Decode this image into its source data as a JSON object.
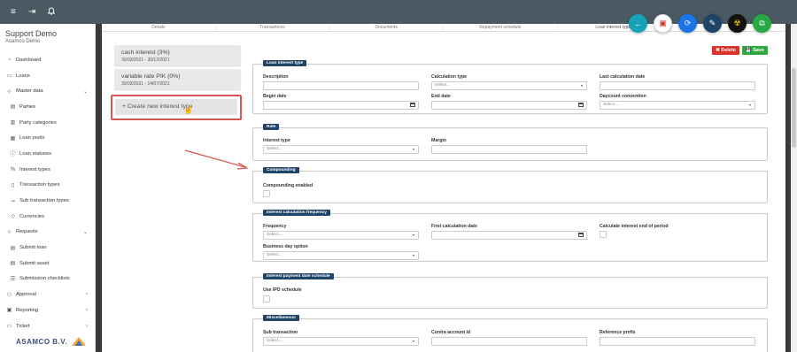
{
  "topbar": {
    "icons": [
      "menu-icon",
      "logout-icon",
      "bell-icon"
    ],
    "glyphs": [
      "≡",
      "⇥",
      "🔔"
    ]
  },
  "sidebar": {
    "org_name": "Support Demo",
    "org_sub": "Asamco Demo",
    "items": [
      {
        "label": "Dashboard",
        "icon": "dashboard-icon",
        "glyph": "◔",
        "sub": false,
        "chevron": ""
      },
      {
        "label": "Loans",
        "icon": "loans-icon",
        "glyph": "▭",
        "sub": false,
        "chevron": ""
      },
      {
        "label": "Master data",
        "icon": "master-data-icon",
        "glyph": "⊹",
        "sub": false,
        "chevron": "⌄"
      },
      {
        "label": "Parties",
        "icon": "parties-icon",
        "glyph": "▤",
        "sub": true,
        "chevron": ""
      },
      {
        "label": "Party categories",
        "icon": "party-categories-icon",
        "glyph": "▥",
        "sub": true,
        "chevron": ""
      },
      {
        "label": "Loan pools",
        "icon": "loan-pools-icon",
        "glyph": "▦",
        "sub": true,
        "chevron": ""
      },
      {
        "label": "Loan statuses",
        "icon": "loan-statuses-icon",
        "glyph": "ⓘ",
        "sub": true,
        "chevron": ""
      },
      {
        "label": "Interest types",
        "icon": "interest-types-icon",
        "glyph": "%",
        "sub": true,
        "chevron": ""
      },
      {
        "label": "Transaction types",
        "icon": "transaction-types-icon",
        "glyph": "▯",
        "sub": true,
        "chevron": ""
      },
      {
        "label": "Sub transaction types",
        "icon": "sub-transaction-types-icon",
        "glyph": "⊸",
        "sub": true,
        "chevron": ""
      },
      {
        "label": "Currencies",
        "icon": "currencies-icon",
        "glyph": "◇",
        "sub": true,
        "chevron": ""
      },
      {
        "label": "Requests",
        "icon": "requests-icon",
        "glyph": "⊹",
        "sub": false,
        "chevron": "⌄"
      },
      {
        "label": "Submit loan",
        "icon": "submit-loan-icon",
        "glyph": "▤",
        "sub": true,
        "chevron": ""
      },
      {
        "label": "Submit asset",
        "icon": "submit-asset-icon",
        "glyph": "▤",
        "sub": true,
        "chevron": ""
      },
      {
        "label": "Submission checklists",
        "icon": "submission-checklists-icon",
        "glyph": "☰",
        "sub": true,
        "chevron": ""
      },
      {
        "label": "Approval",
        "icon": "approval-icon",
        "glyph": "⚇",
        "sub": false,
        "chevron": "›"
      },
      {
        "label": "Reporting",
        "icon": "reporting-icon",
        "glyph": "▣",
        "sub": false,
        "chevron": "›"
      },
      {
        "label": "Ticket",
        "icon": "ticket-icon",
        "glyph": "▭",
        "sub": false,
        "chevron": "›"
      }
    ],
    "logo_text": "ASAMCO B.V."
  },
  "tabs": [
    "Details",
    "Transactions",
    "Documents",
    "Repayment schedule",
    "Loan interest types",
    ""
  ],
  "interest_types": [
    {
      "title": "cash interest (3%)",
      "dates": "30/03/2021 - 30/12/2021"
    },
    {
      "title": "variable rate PIK (0%)",
      "dates": "30/03/2021 - 14/07/2021"
    }
  ],
  "create_button": "+ Create new interest type",
  "actions": {
    "delete": "✖ Delete",
    "save": "💾 Save"
  },
  "fabs": [
    {
      "icon": "back-arrow-icon",
      "glyph": "←",
      "color": "#17a2b8"
    },
    {
      "icon": "pdf-icon",
      "glyph": "▣",
      "color": "#ffffff"
    },
    {
      "icon": "refresh-icon",
      "glyph": "⟳",
      "color": "#1a73e8"
    },
    {
      "icon": "edit-icon",
      "glyph": "✎",
      "color": "#1e4468"
    },
    {
      "icon": "yellow-circle-icon",
      "glyph": "☢",
      "color": "#111111"
    },
    {
      "icon": "copy-icon",
      "glyph": "⧉",
      "color": "#28a745"
    }
  ],
  "sections": {
    "loan_interest_type": {
      "title": "Loan interest type",
      "description_label": "Description",
      "calculation_type_label": "Calculation type",
      "calculation_type_placeholder": "Select...",
      "last_calc_date_label": "Last calculation date",
      "begin_date_label": "Begin date",
      "end_date_label": "End date",
      "daycount_label": "Daycount convention",
      "daycount_placeholder": "Select..."
    },
    "rate": {
      "title": "Rate",
      "interest_type_label": "Interest type",
      "interest_type_placeholder": "Select...",
      "margin_label": "Margin"
    },
    "compounding": {
      "title": "Compounding",
      "enabled_label": "Compounding enabled"
    },
    "frequency": {
      "title": "Interest calculation frequency",
      "frequency_label": "Frequency",
      "frequency_placeholder": "Select...",
      "first_calc_label": "First calculation date",
      "calc_end_label": "Calculate interest end of period",
      "bdo_label": "Business day option",
      "bdo_placeholder": "Select..."
    },
    "payment": {
      "title": "Interest payment date schedule",
      "use_ipd_label": "Use IPD schedule"
    },
    "misc": {
      "title": "Miscellaneous",
      "sub_transaction_label": "Sub transaction",
      "sub_transaction_placeholder": "Select...",
      "contra_label": "Contra account id",
      "ref_prefix_label": "Reference prefix"
    }
  }
}
